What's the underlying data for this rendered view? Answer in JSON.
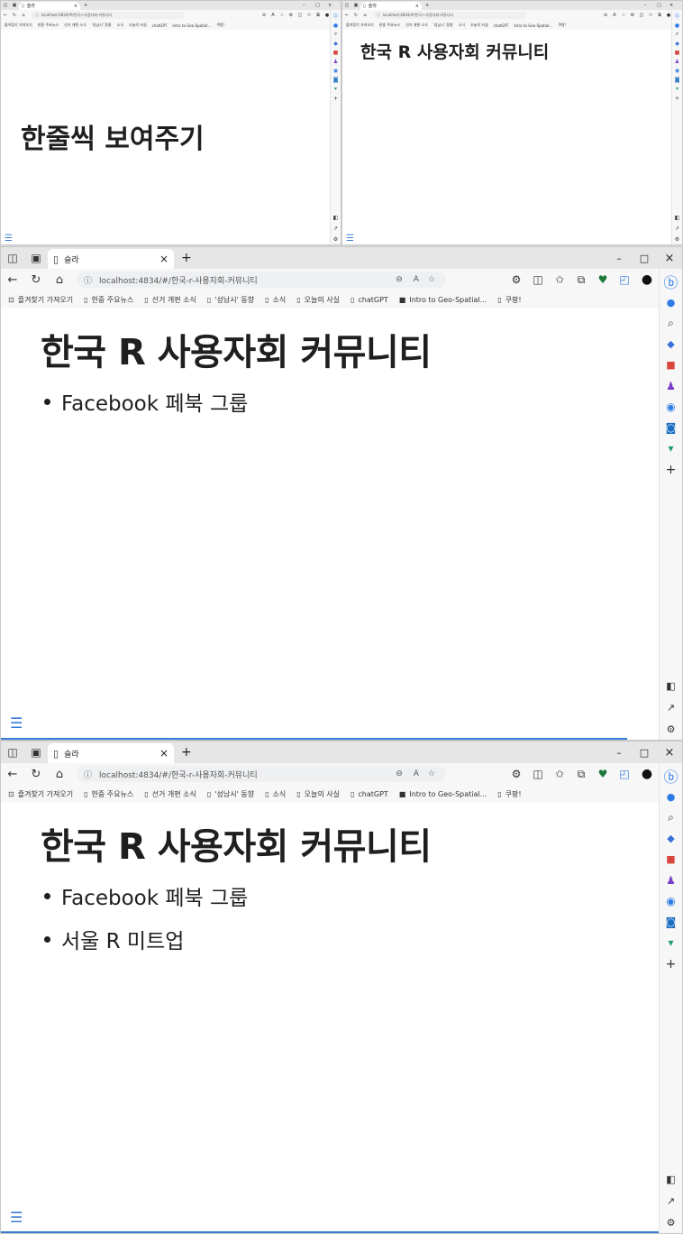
{
  "browser": {
    "tab_title": "슬라",
    "new_tab": "+",
    "close_tab": "×",
    "minimize": "–",
    "maximize": "□",
    "close_window": "×",
    "address": "localhost:4834/#/한국-r-사용자회-커뮤니티",
    "bookmarks": [
      "즐겨찾기 가져오기",
      "한중 주요뉴스",
      "선거 개편 소식",
      "'성남시' 동향",
      "소식",
      "오늘의 사실",
      "chatGPT",
      "Intro to Geo-Spatial...",
      "쿠팡!"
    ]
  },
  "slides": {
    "title_slide": "한줄씩 보여주기",
    "heading": "한국 R 사용자회 커뮤니티",
    "bullets": [
      "Facebook 페북 그룹",
      "서울 R 미트업"
    ]
  }
}
